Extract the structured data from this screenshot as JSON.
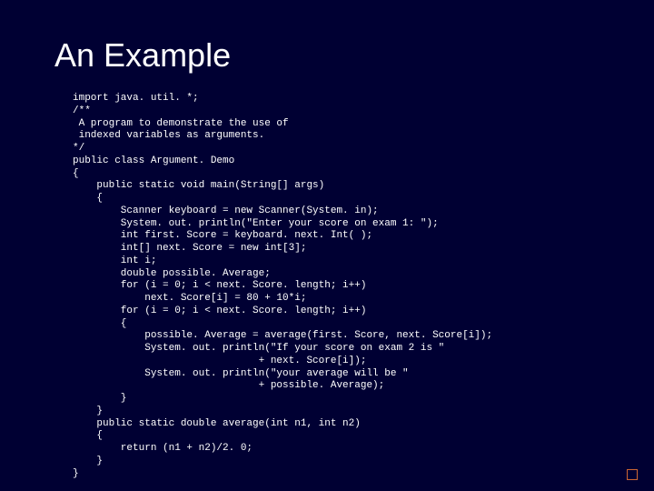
{
  "title": "An Example",
  "code": "import java. util. *;\n/**\n A program to demonstrate the use of\n indexed variables as arguments.\n*/\npublic class Argument. Demo\n{\n    public static void main(String[] args)\n    {\n        Scanner keyboard = new Scanner(System. in);\n        System. out. println(\"Enter your score on exam 1: \");\n        int first. Score = keyboard. next. Int( );\n        int[] next. Score = new int[3];\n        int i;\n        double possible. Average;\n        for (i = 0; i < next. Score. length; i++)\n            next. Score[i] = 80 + 10*i;\n        for (i = 0; i < next. Score. length; i++)\n        {\n            possible. Average = average(first. Score, next. Score[i]);\n            System. out. println(\"If your score on exam 2 is \"\n                               + next. Score[i]);\n            System. out. println(\"your average will be \"\n                               + possible. Average);\n        }\n    }\n    public static double average(int n1, int n2)\n    {\n        return (n1 + n2)/2. 0;\n    }\n}"
}
